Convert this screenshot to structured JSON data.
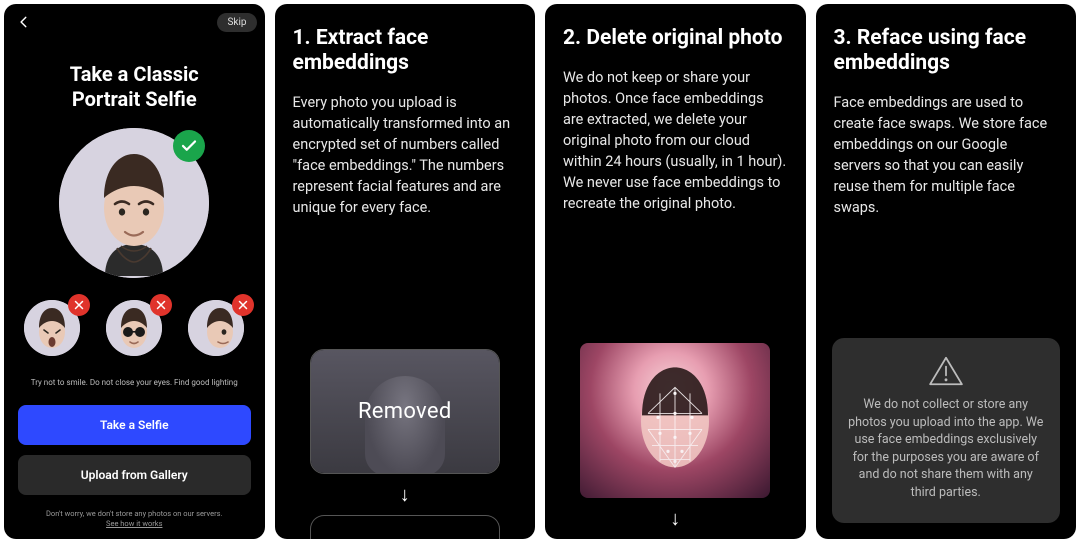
{
  "panel1": {
    "skip": "Skip",
    "title_line1": "Take a Classic",
    "title_line2": "Portrait Selfie",
    "hint": "Try not to smile. Do not close your eyes. Find good lighting",
    "primary_btn": "Take a Selfie",
    "secondary_btn": "Upload from Gallery",
    "disclaimer_line1": "Don't worry, we don't store any photos on our servers.",
    "disclaimer_link": "See how it works"
  },
  "panel2": {
    "title": "1. Extract face embeddings",
    "body": "Every photo you upload is automatically transformed into an encrypted set of numbers called \"face embeddings.\" The numbers represent facial features and are unique for every face.",
    "removed_label": "Removed"
  },
  "panel3": {
    "title": "2. Delete original photo",
    "body": "We do not keep or share your photos. Once face embeddings are extracted, we delete your original photo from our cloud within 24 hours (usually, in 1 hour). We never use face embeddings to recreate the original photo."
  },
  "panel4": {
    "title": "3. Reface using face embeddings",
    "body": "Face embeddings are used to create face swaps. We store face embeddings on our Google servers so that you can easily reuse them for multiple face swaps.",
    "notice": "We do not collect or store any photos you upload into the app. We use face embeddings exclusively for the purposes you are aware of and do not share them with any third parties."
  }
}
